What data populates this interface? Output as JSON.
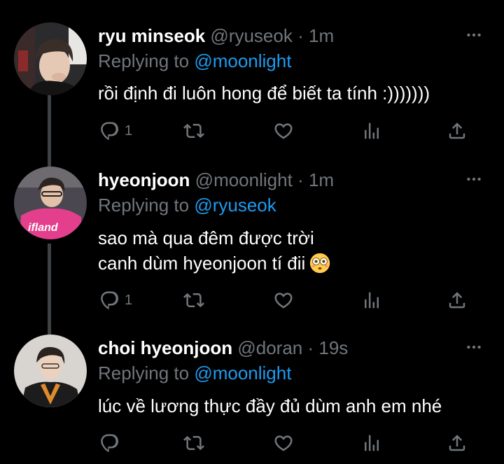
{
  "tweets": [
    {
      "name": "ryu minseok",
      "handle": "@ryuseok",
      "dot": "·",
      "time": "1m",
      "replying_label": "Replying to",
      "replying_to": "@moonlight",
      "lines": [
        "rồi định đi luôn hong để biết ta tính :)))))))"
      ],
      "reply_count": "1"
    },
    {
      "name": "hyeonjoon",
      "handle": "@moonlight",
      "dot": "·",
      "time": "1m",
      "replying_label": "Replying to",
      "replying_to": "@ryuseok",
      "lines": [
        "sao mà qua đêm được trời",
        "canh dùm hyeonjoon tí đii"
      ],
      "reply_count": "1"
    },
    {
      "name": "choi hyeonjoon",
      "handle": "@doran",
      "dot": "·",
      "time": "19s",
      "replying_label": "Replying to",
      "replying_to": "@moonlight",
      "lines": [
        "lúc về lương thực đầy đủ dùm anh em nhé"
      ],
      "reply_count": ""
    }
  ],
  "colors": {
    "background": "#000000",
    "secondary_text": "#71767b",
    "link": "#1d9bf0",
    "thread_line": "#3d4144"
  },
  "icons": {
    "reply": "reply-icon",
    "retweet": "retweet-icon",
    "like": "heart-icon",
    "views": "analytics-icon",
    "share": "share-icon",
    "more": "more-icon",
    "emoji": "flushed-face-emoji"
  }
}
